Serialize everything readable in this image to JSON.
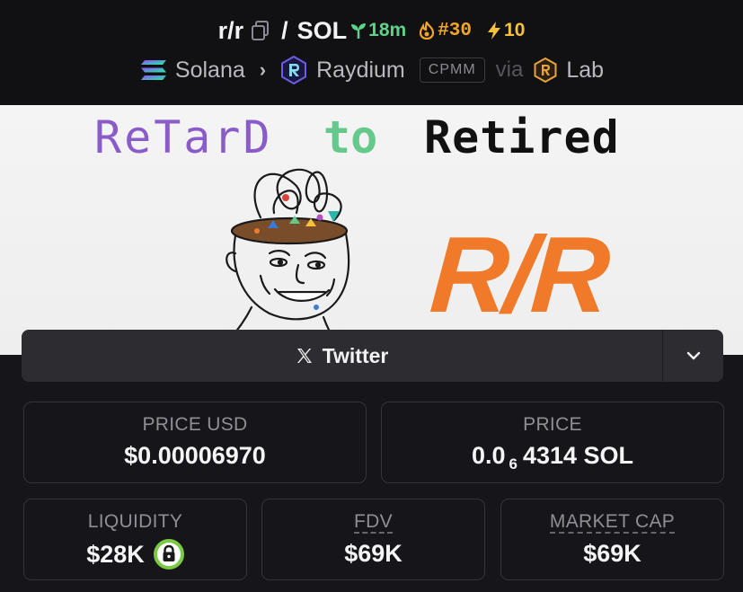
{
  "header": {
    "ticker": "r/r",
    "quote": "SOL",
    "age": "18m",
    "rank": "#30",
    "boosts": "10",
    "chain": "Solana",
    "dex": "Raydium",
    "pool_type": "CPMM",
    "via_word": "via",
    "launchpad": "Lab",
    "colors": {
      "age": "#5fd28a",
      "rank": "#f6a623",
      "boost": "#f6c23e"
    }
  },
  "banner": {
    "word1": "ReTarD",
    "word2": "to",
    "word3": "Retired",
    "big_text": "R/R",
    "colors": {
      "word1": "#8a5cc9",
      "word2": "#66c98c",
      "word3": "#111111",
      "big": "#f07a2a"
    }
  },
  "social": {
    "label": "Twitter",
    "icon": "x-logo-icon"
  },
  "stats": {
    "price_usd": {
      "label": "PRICE USD",
      "value": "$0.00006970"
    },
    "price": {
      "label": "PRICE",
      "lead": "0.0",
      "zeros": "6",
      "tail": "4314 SOL"
    },
    "liquidity": {
      "label": "LIQUIDITY",
      "value": "$28K",
      "icon": "lock-icon"
    },
    "fdv": {
      "label": "FDV",
      "value": "$69K"
    },
    "market_cap": {
      "label": "MARKET CAP",
      "value": "$69K"
    }
  }
}
